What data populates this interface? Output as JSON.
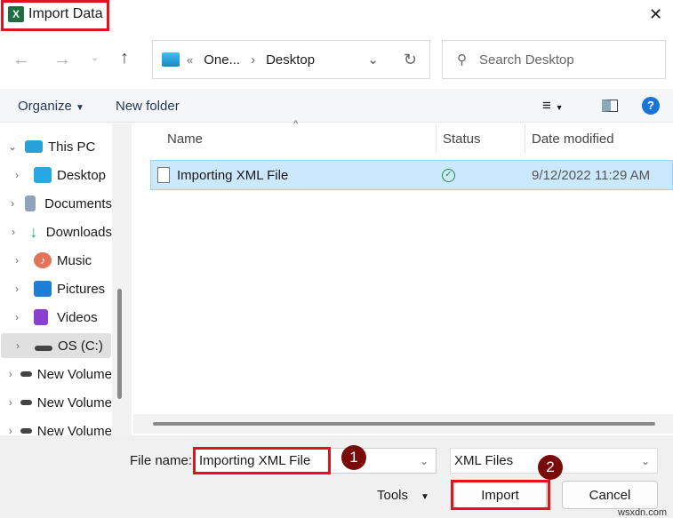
{
  "window": {
    "title": "Import Data",
    "close": "✕"
  },
  "nav": {
    "path_prefix": "«",
    "path_parent": "One...",
    "path_sep": "›",
    "path_current": "Desktop",
    "search_placeholder": "Search Desktop"
  },
  "toolbar": {
    "organize": "Organize",
    "new_folder": "New folder"
  },
  "sidebar": {
    "items": [
      {
        "label": "This PC",
        "expanded": true
      },
      {
        "label": "Desktop"
      },
      {
        "label": "Documents"
      },
      {
        "label": "Downloads"
      },
      {
        "label": "Music"
      },
      {
        "label": "Pictures"
      },
      {
        "label": "Videos"
      },
      {
        "label": "OS (C:)"
      },
      {
        "label": "New Volume"
      },
      {
        "label": "New Volume"
      },
      {
        "label": "New Volume"
      }
    ]
  },
  "columns": {
    "name": "Name",
    "status": "Status",
    "date": "Date modified"
  },
  "files": [
    {
      "name": "Importing XML File",
      "status": "synced",
      "date": "9/12/2022 11:29 AM"
    }
  ],
  "footer": {
    "file_name_label": "File name:",
    "file_name_value": "Importing XML File",
    "file_type": "XML Files",
    "tools": "Tools",
    "import": "Import",
    "cancel": "Cancel"
  },
  "annotations": {
    "step1": "1",
    "step2": "2"
  },
  "watermark": "wsxdn.com"
}
